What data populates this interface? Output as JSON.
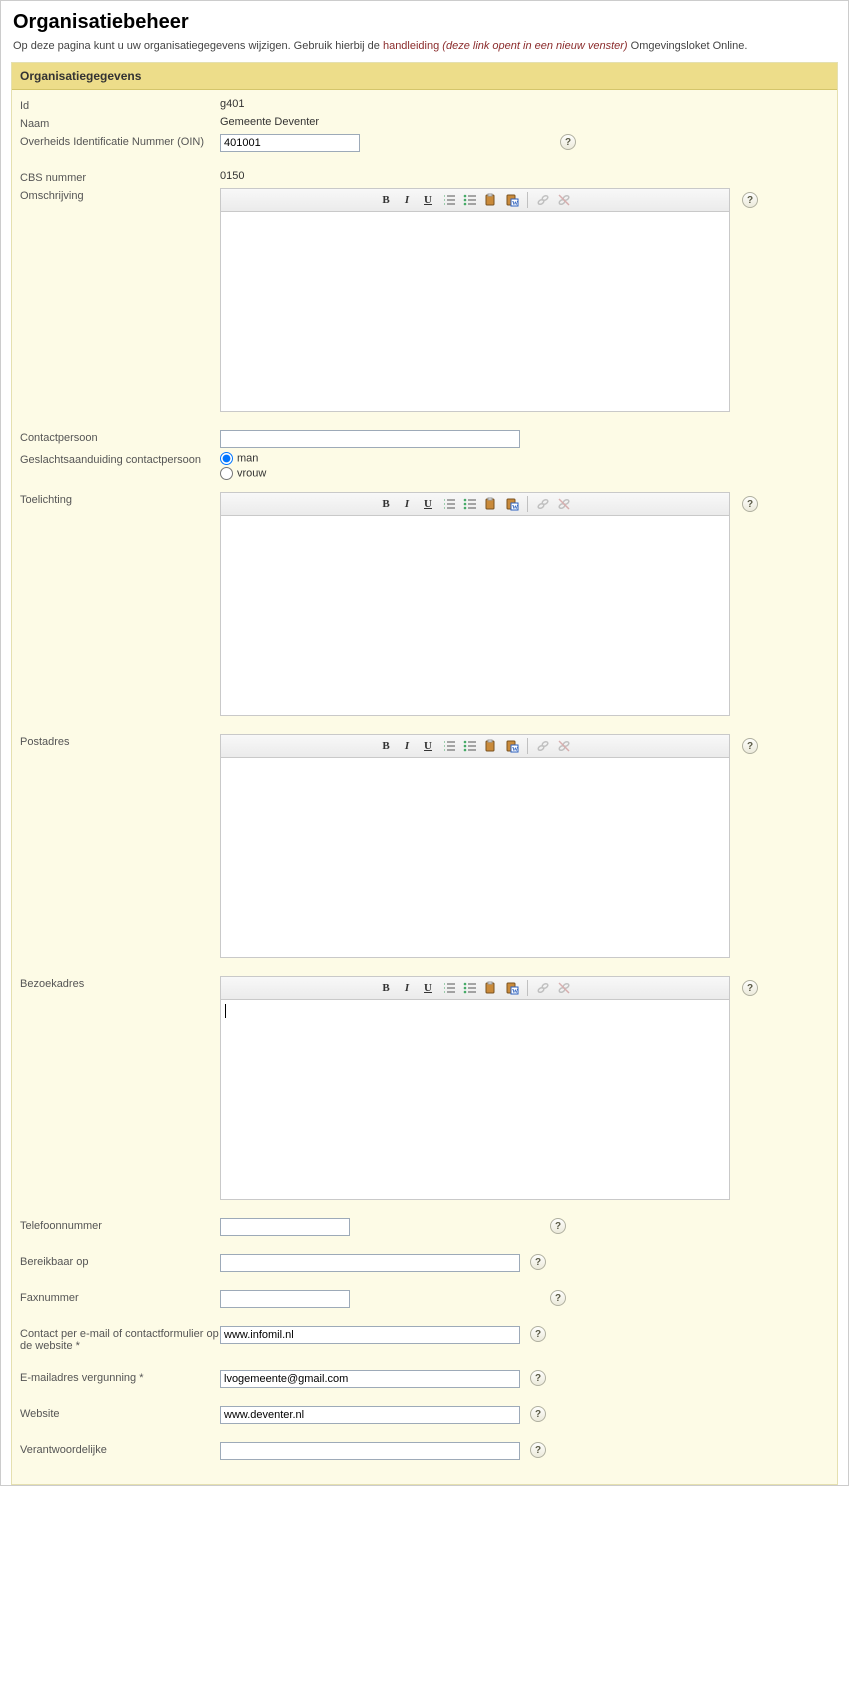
{
  "page": {
    "title": "Organisatiebeheer",
    "intro_pre": "Op deze pagina kunt u uw organisatiegegevens wijzigen. Gebruik hierbij de ",
    "intro_link": "handleiding",
    "intro_em": "(deze link opent in een nieuw venster)",
    "intro_post": " Omgevingsloket Online."
  },
  "panel": {
    "title": "Organisatiegegevens"
  },
  "labels": {
    "id": "Id",
    "naam": "Naam",
    "oin": "Overheids Identificatie Nummer (OIN)",
    "cbs": "CBS nummer",
    "omschrijving": "Omschrijving",
    "contactpersoon": "Contactpersoon",
    "geslacht": "Geslachtsaanduiding contactpersoon",
    "toelichting": "Toelichting",
    "postadres": "Postadres",
    "bezoekadres": "Bezoekadres",
    "telefoon": "Telefoonnummer",
    "bereikbaar": "Bereikbaar op",
    "fax": "Faxnummer",
    "contact_email": "Contact per e-mail of contactformulier op de website *",
    "email_vergunning": "E-mailadres vergunning *",
    "website": "Website",
    "verantwoordelijke": "Verantwoordelijke"
  },
  "values": {
    "id": "g401",
    "naam": "Gemeente Deventer",
    "oin": "401001",
    "cbs": "0150",
    "omschrijving": "",
    "contactpersoon": "",
    "geslacht_selected": "man",
    "geslacht_man": "man",
    "geslacht_vrouw": "vrouw",
    "toelichting": "",
    "postadres": "",
    "bezoekadres": "",
    "telefoon": "",
    "bereikbaar": "",
    "fax": "",
    "contact_email": "www.infomil.nl",
    "email_vergunning": "lvogemeente@gmail.com",
    "website": "www.deventer.nl",
    "verantwoordelijke": ""
  },
  "help_glyph": "?"
}
